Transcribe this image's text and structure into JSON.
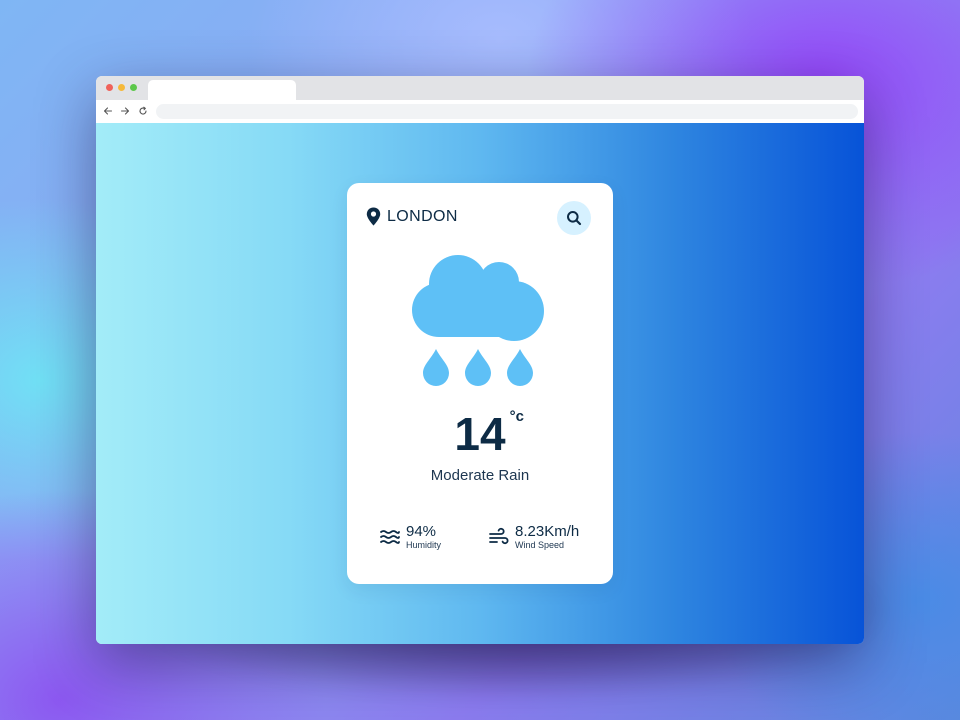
{
  "browser": {
    "traffic_colors": {
      "close": "#f0625a",
      "minimize": "#f5b93a",
      "zoom": "#5cc84b"
    },
    "nav_icons": [
      "back-arrow-icon",
      "forward-arrow-icon",
      "reload-icon"
    ],
    "address_value": ""
  },
  "weather": {
    "city": "LONDON",
    "temperature": "14",
    "unit": "°c",
    "condition": "Moderate Rain",
    "icon": "rain-cloud-icon",
    "humidity": {
      "value": "94%",
      "label": "Humidity",
      "icon": "humidity-waves-icon"
    },
    "wind": {
      "value": "8.23Km/h",
      "label": "Wind Speed",
      "icon": "wind-icon"
    }
  },
  "colors": {
    "card": "#ffffff",
    "text_dark": "#0d2b45",
    "icon_blue": "#5ec0f6",
    "search_bg": "#d6f1ff",
    "gradient_start": "#a3ecf8",
    "gradient_end": "#0753d8"
  }
}
